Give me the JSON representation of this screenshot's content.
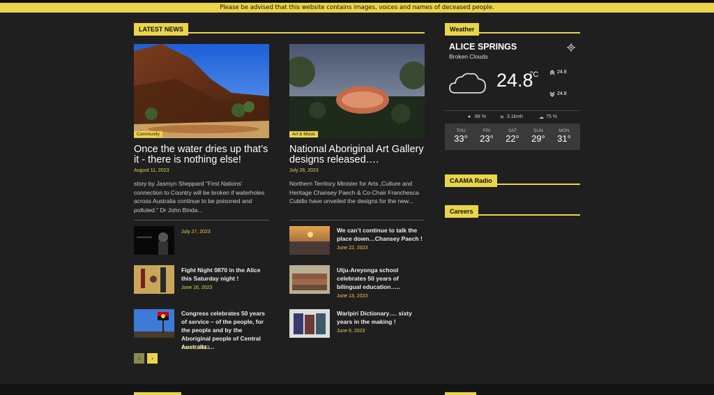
{
  "notice": "Please be advised that this website contains images, voices and names of deceased people.",
  "sections": {
    "latest_news": "LATEST NEWS",
    "weather": "Weather",
    "caama_radio": "CAAMA Radio",
    "careers": "Careers"
  },
  "featured": [
    {
      "tag": "Community",
      "title": "Once the water dries up that’s it - there is nothing else!",
      "date": "August 11, 2023",
      "excerpt": "story by Jasmyn Sheppard \"First Nations' connection to Country will be broken if waterholes across Australia continue to be poisoned and polluted.\" Dr John Binda..."
    },
    {
      "tag": "Art & Music",
      "title": "National Aboriginal Art Gallery designs released….",
      "date": "July 28, 2023",
      "excerpt": "Northern Territory Minister for Arts ,Culture and Heritage Chansey Paech & Co-Chair Franchesca Cubillo have unveiled the designs for the new..."
    }
  ],
  "list": {
    "left": [
      {
        "title": "",
        "date": "July 27, 2023"
      },
      {
        "title": "Fight Night 0870 in the Alice this Saturday night !",
        "date": "June 16, 2023"
      },
      {
        "title": "Congress celebrates 50 years of service – of the people, for the people and by the Aboriginal people of Central Australia….",
        "date": "June 9, 2023"
      }
    ],
    "right": [
      {
        "title": "We can’t continue to talk the place down…Chansey Paech !",
        "date": "June 22, 2023"
      },
      {
        "title": "Utju-Areyonga school celebrates 50 years of bilingual education…..",
        "date": "June 13, 2023"
      },
      {
        "title": "Warlpiri Dictionary…. sixty years in the making !",
        "date": "June 6, 2023"
      }
    ]
  },
  "pager": {
    "prev": "‹",
    "next": "›"
  },
  "weather": {
    "city": "ALICE SPRINGS",
    "description": "Broken Clouds",
    "temp": "24.8",
    "unit": "°C",
    "high": "24.8",
    "low": "24.8",
    "humidity": "88 %",
    "wind": "3.1kmh",
    "clouds": "75 %",
    "forecast": [
      {
        "day": "THU",
        "temp": "33°"
      },
      {
        "day": "FRI",
        "temp": "23°"
      },
      {
        "day": "SAT",
        "temp": "22°"
      },
      {
        "day": "SUN",
        "temp": "29°"
      },
      {
        "day": "MON",
        "temp": "31°"
      }
    ]
  },
  "colors": {
    "accent": "#ead44a",
    "background": "#1f1f1f"
  }
}
